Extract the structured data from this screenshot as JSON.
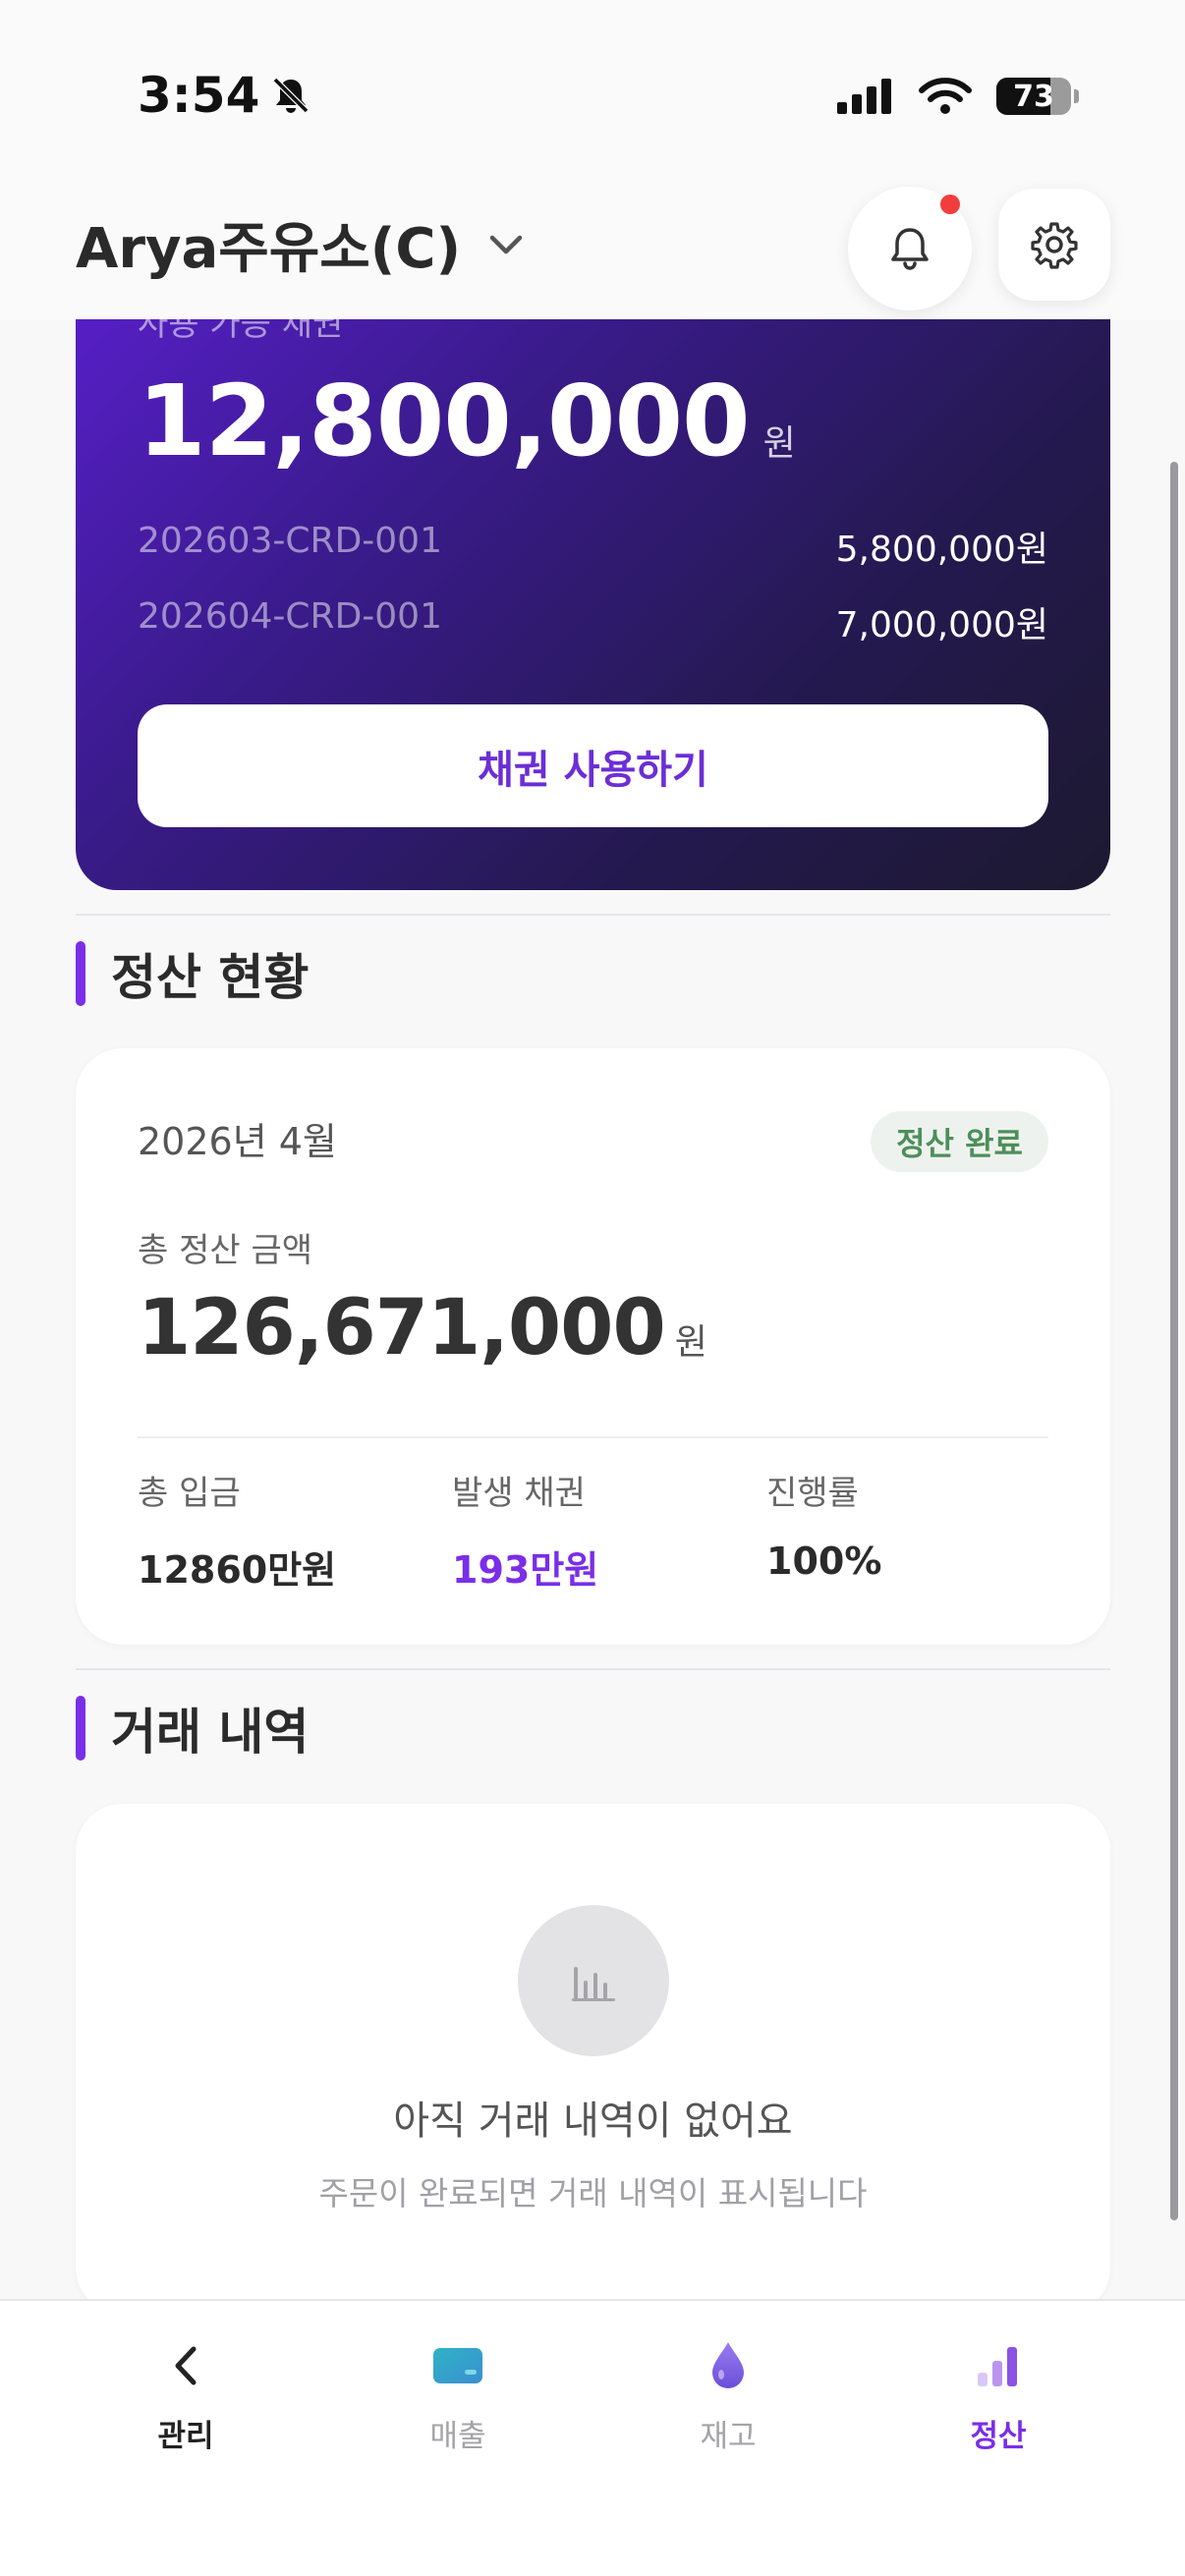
{
  "status_bar": {
    "time": "3:54",
    "battery_percent": "73",
    "battery_level": 0.73
  },
  "header": {
    "station_name": "Arya주유소(C)"
  },
  "credit_card": {
    "label": "사용 가능 채권",
    "amount": "12,800,000",
    "unit": "원",
    "items": [
      {
        "code": "202603-CRD-001",
        "amount": "5,800,000원"
      },
      {
        "code": "202604-CRD-001",
        "amount": "7,000,000원"
      }
    ],
    "use_button_label": "채권 사용하기"
  },
  "settlement": {
    "section_title": "정산 현황",
    "month": "2026년 4월",
    "badge": "정산 완료",
    "total_label": "총 정산 금액",
    "total_amount": "126,671,000",
    "total_unit": "원",
    "stats": [
      {
        "label": "총 입금",
        "value": "12860만원"
      },
      {
        "label": "발생 채권",
        "value": "193만원"
      },
      {
        "label": "진행률",
        "value": "100%"
      }
    ]
  },
  "transactions": {
    "section_title": "거래 내역",
    "empty_title": "아직 거래 내역이 없어요",
    "empty_subtitle": "주문이 완료되면 거래 내역이 표시됩니다"
  },
  "tabbar": {
    "tabs": [
      {
        "label": "관리",
        "icon": "chevron-left-icon"
      },
      {
        "label": "매출",
        "icon": "card-icon"
      },
      {
        "label": "재고",
        "icon": "drop-icon"
      },
      {
        "label": "정산",
        "icon": "bar-chart-icon",
        "active": true
      }
    ]
  },
  "colors": {
    "accent": "#7a2ee8",
    "badge_green": "#4c8f5a",
    "notification_dot": "#f23d3d"
  }
}
